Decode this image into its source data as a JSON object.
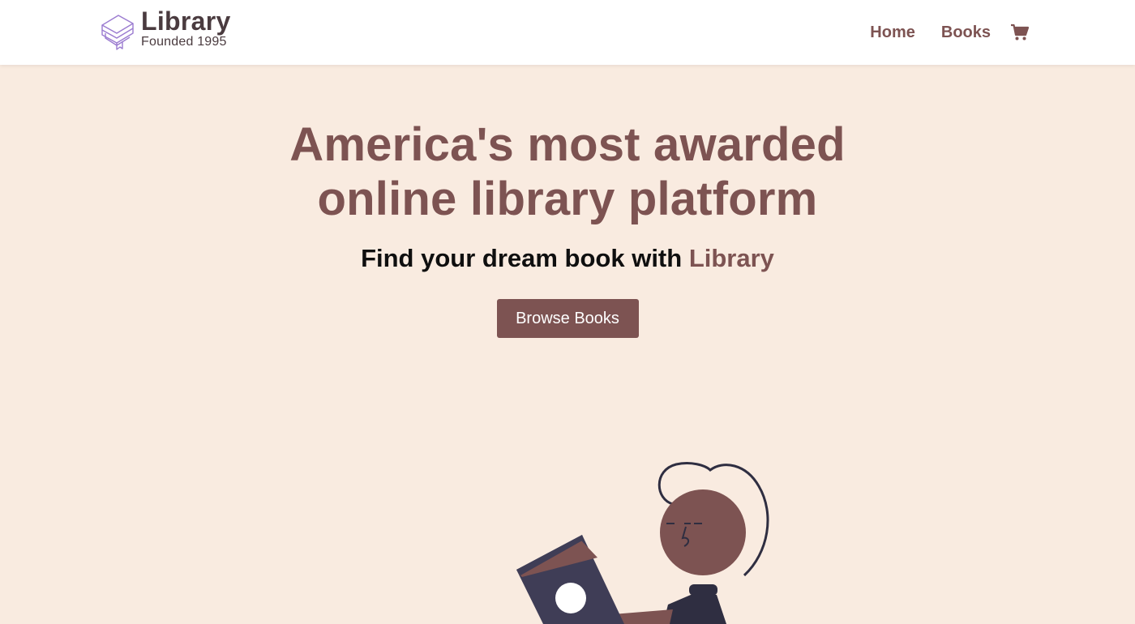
{
  "brand": {
    "name": "Library",
    "tagline": "Founded 1995",
    "icon": "stacked-books-icon"
  },
  "nav": {
    "links": [
      {
        "label": "Home"
      },
      {
        "label": "Books"
      }
    ],
    "cart_icon": "shopping-cart-icon"
  },
  "hero": {
    "title_line1": "America's most awarded",
    "title_line2": "online library platform",
    "subtitle_prefix": "Find your dream book with ",
    "subtitle_accent": "Library",
    "cta_label": "Browse Books"
  },
  "illustration": {
    "icon": "person-reading-book-illustration"
  },
  "colors": {
    "background": "#f9ebe0",
    "accent": "#7d5352",
    "navbar": "#ffffff",
    "dark": "#2f2e41",
    "book": "#3f3d56"
  }
}
